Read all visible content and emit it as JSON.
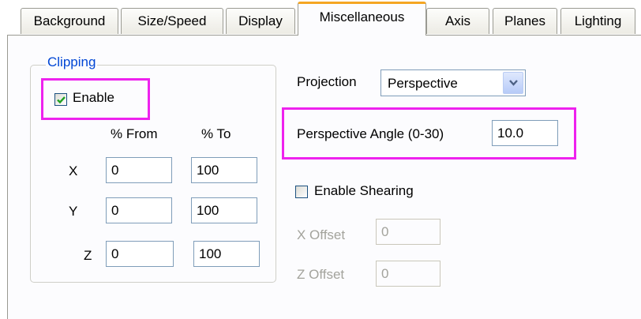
{
  "tabs": [
    {
      "label": "Background"
    },
    {
      "label": "Size/Speed"
    },
    {
      "label": "Display"
    },
    {
      "label": "Miscellaneous",
      "active": true
    },
    {
      "label": "Axis"
    },
    {
      "label": "Planes"
    },
    {
      "label": "Lighting"
    }
  ],
  "clipping": {
    "title": "Clipping",
    "enable_label": "Enable",
    "enable_checked": true,
    "col_from": "% From",
    "col_to": "% To",
    "rows": [
      {
        "axis": "X",
        "from": "0",
        "to": "100"
      },
      {
        "axis": "Y",
        "from": "0",
        "to": "100"
      },
      {
        "axis": "Z",
        "from": "0",
        "to": "100"
      }
    ]
  },
  "projection": {
    "label": "Projection",
    "value": "Perspective"
  },
  "perspective_angle": {
    "label": "Perspective Angle (0-30)",
    "value": "10.0"
  },
  "shearing": {
    "label": "Enable Shearing",
    "checked": false,
    "x_offset_label": "X Offset",
    "x_offset_value": "0",
    "z_offset_label": "Z Offset",
    "z_offset_value": "0"
  },
  "colors": {
    "highlight": "#ee22ee",
    "active_tab_accent": "#f5a623",
    "group_title": "#0046d5"
  },
  "icons": {
    "dropdown": "chevron-down-icon",
    "checkmark": "checkmark-icon"
  }
}
